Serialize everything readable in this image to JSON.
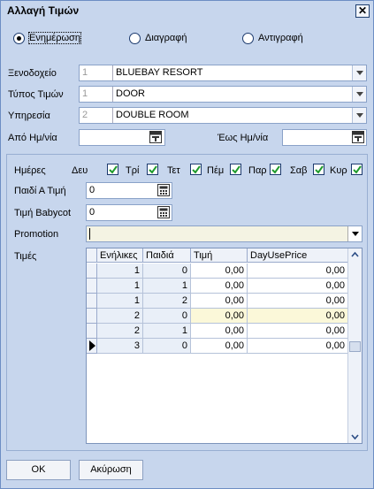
{
  "window": {
    "title": "Αλλαγή Τιμών",
    "close_glyph": "✕"
  },
  "mode": {
    "options": [
      {
        "label": "Ενημέρωση",
        "selected": true
      },
      {
        "label": "Διαγραφή",
        "selected": false
      },
      {
        "label": "Αντιγραφή",
        "selected": false
      }
    ]
  },
  "hotel": {
    "label": "Ξενοδοχείο",
    "code": "1",
    "value": "BLUEBAY RESORT"
  },
  "price_type": {
    "label": "Τύπος Τιμών",
    "code": "1",
    "value": "DOOR"
  },
  "service": {
    "label": "Υπηρεσία",
    "code": "2",
    "value": "DOUBLE ROOM"
  },
  "date_from": {
    "label": "Από Ημ/νία",
    "value": ""
  },
  "date_to": {
    "label": "Έως Ημ/νία",
    "value": ""
  },
  "days": {
    "label": "Ημέρες",
    "items": [
      {
        "label": "Δευ",
        "checked": true
      },
      {
        "label": "Τρί",
        "checked": true
      },
      {
        "label": "Τετ",
        "checked": true
      },
      {
        "label": "Πέμ",
        "checked": true
      },
      {
        "label": "Παρ",
        "checked": true
      },
      {
        "label": "Σαβ",
        "checked": true
      },
      {
        "label": "Κυρ",
        "checked": true
      }
    ]
  },
  "child_a_price": {
    "label": "Παιδί Α Τιμή",
    "value": "0"
  },
  "babycot_price": {
    "label": "Τιμή Babycot",
    "value": "0"
  },
  "promotion": {
    "label": "Promotion",
    "value": ""
  },
  "prices": {
    "label": "Τιμές",
    "columns": [
      "Ενήλικες",
      "Παιδιά",
      "Τιμή",
      "DayUsePrice"
    ],
    "rows": [
      [
        "1",
        "0",
        "0,00",
        "0,00"
      ],
      [
        "1",
        "1",
        "0,00",
        "0,00"
      ],
      [
        "1",
        "2",
        "0,00",
        "0,00"
      ],
      [
        "2",
        "0",
        "0,00",
        "0,00"
      ],
      [
        "2",
        "1",
        "0,00",
        "0,00"
      ],
      [
        "3",
        "0",
        "0,00",
        "0,00"
      ]
    ],
    "current_row": 5,
    "highlighted_row": 3
  },
  "buttons": {
    "ok": "OK",
    "cancel": "Ακύρωση"
  }
}
